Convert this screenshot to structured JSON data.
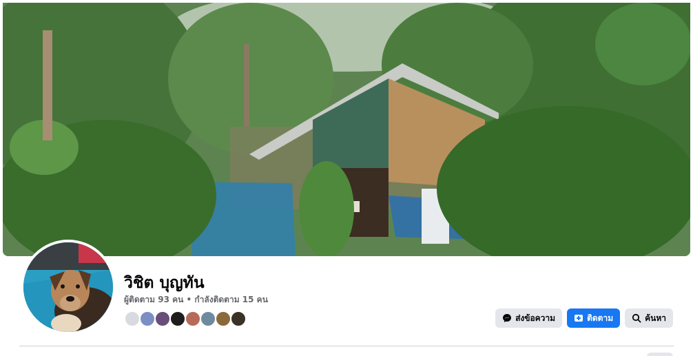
{
  "profile": {
    "name": "วิชิต บุญทัน",
    "stats": "ผู้ติดตาม 93 คน • กำลังติดตาม 15 คน"
  },
  "actions": {
    "message_label": "ส่งข้อความ",
    "follow_label": "ติดตาม",
    "search_label": "ค้นหา"
  },
  "colors": {
    "accent": "#1877f2",
    "button_grey": "#e4e6eb",
    "secondary_text": "#65676b"
  },
  "icons": {
    "message": "messenger-icon",
    "follow": "follow-icon",
    "search": "search-icon"
  },
  "follower_avatars_count": 8
}
